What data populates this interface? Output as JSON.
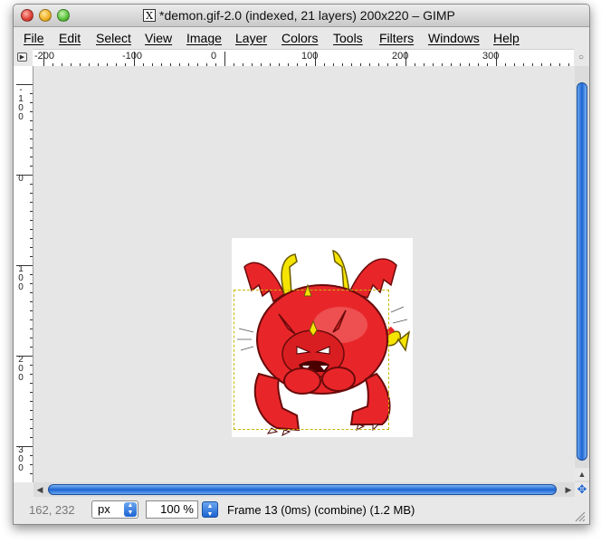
{
  "window": {
    "title": "*demon.gif-2.0 (indexed, 21 layers) 200x220 – GIMP",
    "x11_icon": "X"
  },
  "menu": [
    "File",
    "Edit",
    "Select",
    "View",
    "Image",
    "Layer",
    "Colors",
    "Tools",
    "Filters",
    "Windows",
    "Help"
  ],
  "ruler": {
    "horizontal": [
      "-200",
      "-100",
      "0",
      "100",
      "200",
      "300"
    ],
    "vertical": [
      "-100",
      "0",
      "100",
      "200",
      "300"
    ]
  },
  "icons": {
    "corner_menu": "triangle-right-icon",
    "zoom_toggle": "circle-icon",
    "navigate": "navigate-cross-arrows-icon",
    "resize_grip": "resize-grip-icon"
  },
  "status": {
    "coords": "162, 232",
    "unit": "px",
    "zoom": "100 %",
    "text": "Frame 13 (0ms) (combine) (1.2 MB)"
  },
  "colors": {
    "scroll_accent": "#1d64d2",
    "demon_red": "#e8262a",
    "wing_yellow": "#f5e400",
    "layer_boundary": "#c4b800"
  }
}
